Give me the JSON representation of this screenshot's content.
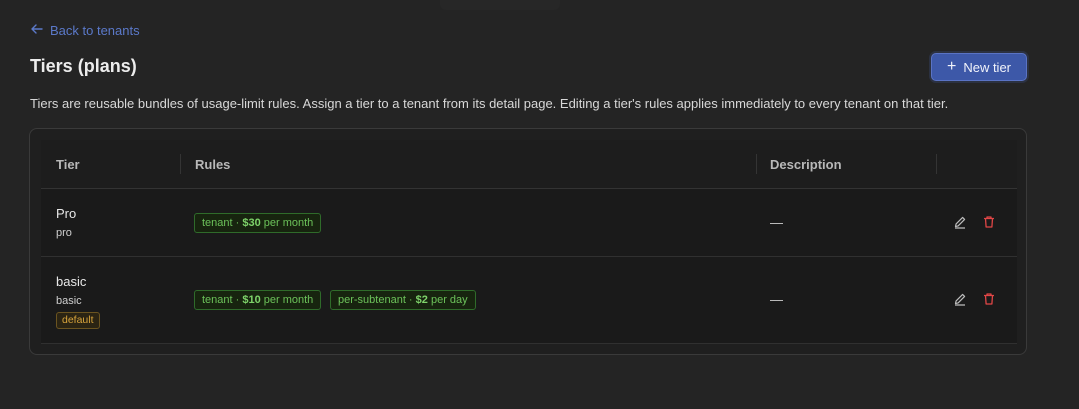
{
  "nav": {
    "back_label": "Back to tenants"
  },
  "header": {
    "title": "Tiers (plans)",
    "new_tier_label": "New tier"
  },
  "description": "Tiers are reusable bundles of usage-limit rules. Assign a tier to a tenant from its detail page. Editing a tier's rules applies immediately to every tenant on that tier.",
  "table": {
    "columns": [
      "Tier",
      "Rules",
      "Description",
      ""
    ],
    "rows": [
      {
        "name": "Pro",
        "slug": "pro",
        "badge": null,
        "rules": [
          {
            "scope": "tenant · ",
            "amount": "$30",
            "period": " per month"
          }
        ],
        "description": "—"
      },
      {
        "name": "basic",
        "slug": "basic",
        "badge": "default",
        "rules": [
          {
            "scope": "tenant · ",
            "amount": "$10",
            "period": " per month"
          },
          {
            "scope": "per-subtenant · ",
            "amount": "$2",
            "period": " per day"
          }
        ],
        "description": "—"
      }
    ]
  },
  "icons": {
    "back": "arrow-left-icon",
    "add": "plus-icon",
    "edit": "pencil-icon",
    "delete": "trash-icon"
  },
  "colors": {
    "accent": "#3d58a8",
    "link": "#5b79c9",
    "rule_green": "#6cc25a",
    "danger": "#e04646",
    "badge_amber": "#d8a43c"
  }
}
